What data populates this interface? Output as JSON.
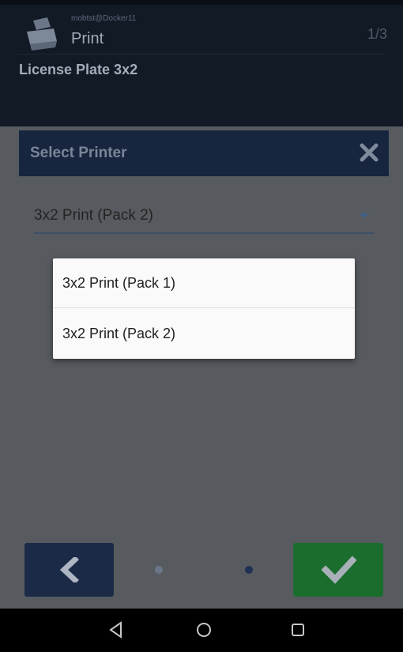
{
  "header": {
    "user": "mobtst@Docker11",
    "title": "Print",
    "page_counter": "1/3",
    "subtitle": "License Plate 3x2"
  },
  "dialog": {
    "title": "Select Printer",
    "selected_printer": "3x2 Print (Pack 2)",
    "options": [
      {
        "label": "3x2 Print (Pack 1)"
      },
      {
        "label": "3x2 Print (Pack 2)"
      }
    ]
  },
  "footer": {
    "page_dots": 2,
    "active_dot": 2
  },
  "icons": {
    "header": "printer-icon",
    "close": "close-icon",
    "back": "chevron-left-icon",
    "confirm": "checkmark-icon",
    "nav": [
      "nav-back-icon",
      "nav-home-icon",
      "nav-recent-icon"
    ]
  },
  "colors": {
    "header_bg": "#121a25",
    "dialog_header_bg": "#17253f",
    "back_button": "#1b2a47",
    "confirm_button": "#1a6d2d",
    "overlay": "#575b5f",
    "underline": "#3c4f67"
  }
}
